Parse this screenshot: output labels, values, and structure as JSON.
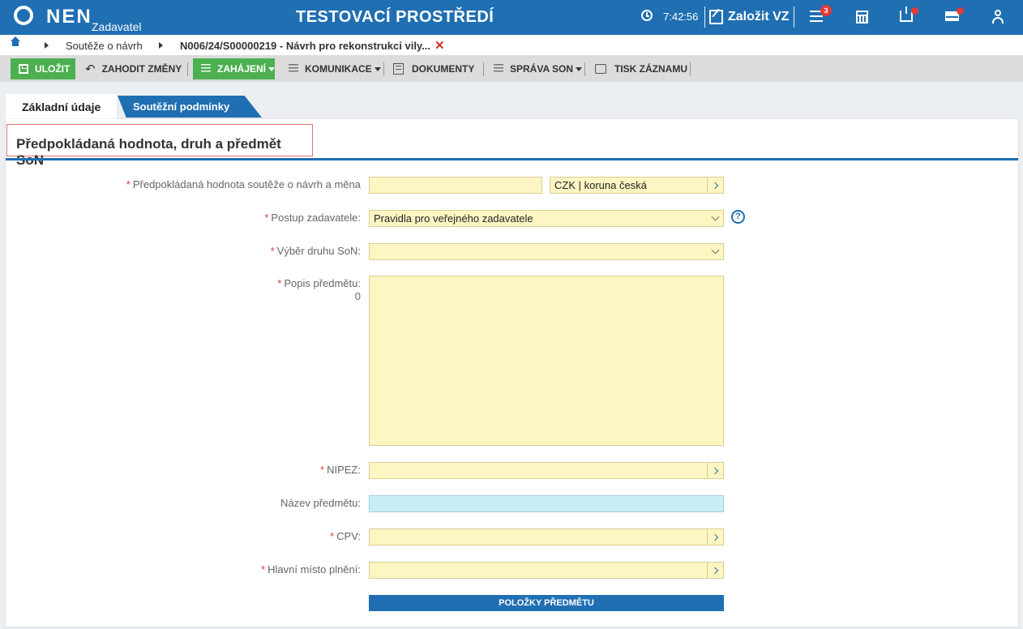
{
  "topbar": {
    "logo": "NEN",
    "logo_sub": "Zadavatel",
    "env_title": "TESTOVACÍ PROSTŘEDÍ",
    "clock": "7:42:56",
    "new_vz": "Založit VZ",
    "notifications_count": "3",
    "icons": [
      "clock-icon",
      "edit-icon",
      "menu-icon",
      "calculator-icon",
      "inbox-icon",
      "mail-icon",
      "user-icon"
    ]
  },
  "breadcrumb": {
    "items": [
      "Soutěže o návrh",
      "N006/24/S00000219 - Návrh pro rekonstrukci vily..."
    ],
    "close": "✕"
  },
  "toolbar": {
    "save": "ULOŽIT",
    "discard": "ZAHODIT ZMĚNY",
    "start": "ZAHÁJENÍ",
    "communication": "KOMUNIKACE",
    "documents": "DOKUMENTY",
    "son_admin": "SPRÁVA SON",
    "print": "TISK ZÁZNAMU"
  },
  "tabs": [
    {
      "label": "Základní údaje",
      "active": true
    },
    {
      "label": "Soutěžní podmínky",
      "active": false
    }
  ],
  "form": {
    "section_title": "Předpokládaná hodnota, druh a předmět SoN",
    "fields": {
      "value_label": "Předpokládaná hodnota soutěže o návrh a měna",
      "value": "",
      "currency": "CZK | koruna česká",
      "procedure_label": "Postup zadavatele:",
      "procedure": "Pravidla pro veřejného zadavatele",
      "type_label": "Výběr druhu SoN:",
      "type": "",
      "description_label": "Popis předmětu:",
      "description_count": "0",
      "description": "",
      "nipez_label": "NIPEZ:",
      "nipez": "",
      "subject_name_label": "Název předmětu:",
      "subject_name": "",
      "cpv_label": "CPV:",
      "cpv": "",
      "place_label": "Hlavní místo plnění:",
      "place": ""
    },
    "items_button": "POLOŽKY PŘEDMĚTU"
  },
  "colors": {
    "brand": "#1f6fb2",
    "green": "#4caf50",
    "required_field": "#fdf6c3",
    "readonly_field": "#c8eef4",
    "required_marker": "#e53935"
  }
}
